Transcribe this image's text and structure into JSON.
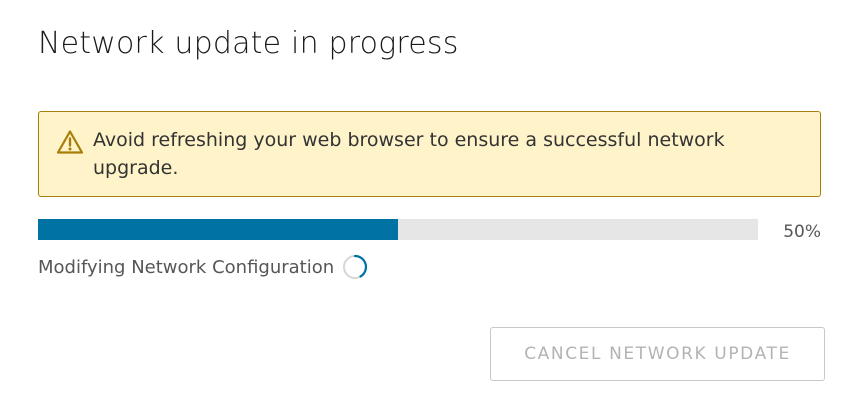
{
  "dialog": {
    "title": "Network update in progress"
  },
  "alert": {
    "icon": "warning-triangle-icon",
    "message": "Avoid refreshing your web browser to ensure a successful network upgrade.",
    "background_color": "#fef3c9",
    "border_color": "#a87e0a"
  },
  "progress": {
    "value": 0.5,
    "percent_label": "50%",
    "fill_color": "#0072a3",
    "track_color": "#e6e6e6",
    "status_text": "Modifying Network Configuration",
    "status_icon": "loading-spinner-icon"
  },
  "actions": {
    "cancel_label": "CANCEL NETWORK UPDATE",
    "cancel_disabled": true
  }
}
